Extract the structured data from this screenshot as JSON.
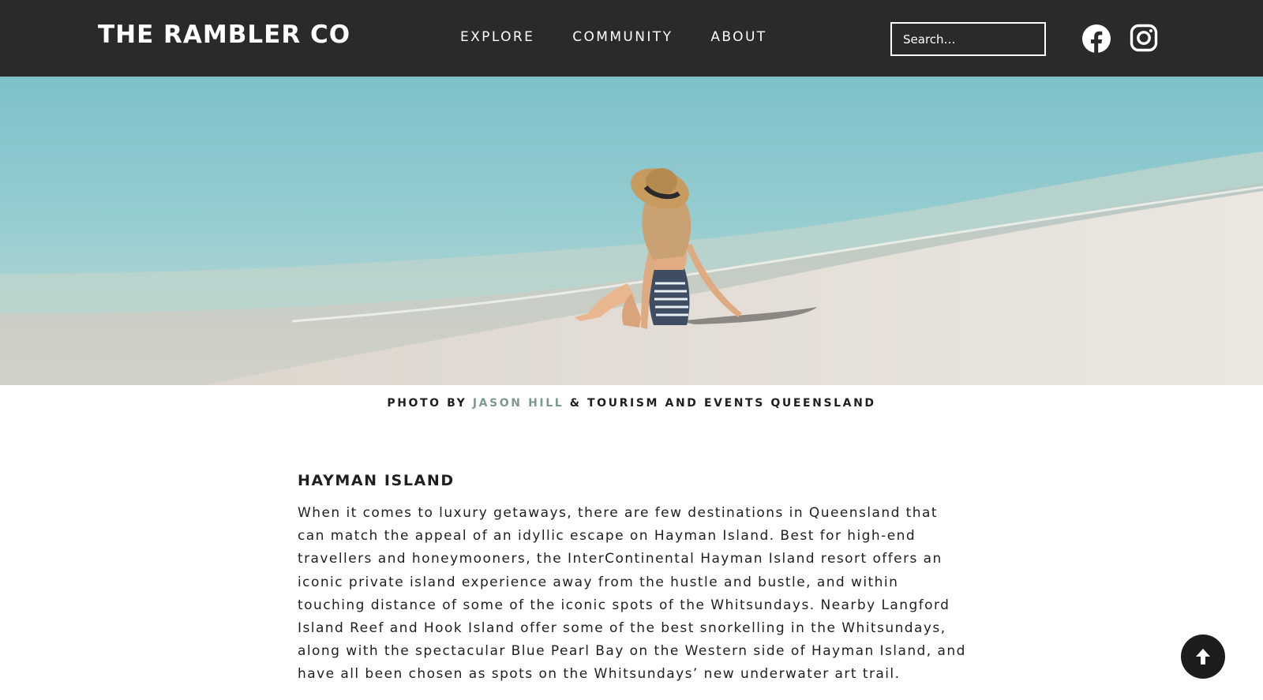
{
  "header": {
    "logo": "THE RAMBLER CO",
    "nav": [
      {
        "label": "EXPLORE"
      },
      {
        "label": "COMMUNITY"
      },
      {
        "label": "ABOUT"
      }
    ],
    "search": {
      "placeholder": "Search…"
    },
    "social": [
      {
        "icon": "facebook-icon"
      },
      {
        "icon": "instagram-icon"
      }
    ]
  },
  "hero": {
    "image": "woman-in-straw-hat-sitting-on-beach"
  },
  "caption": {
    "prefix": "PHOTO BY ",
    "photographer": "JASON HILL",
    "suffix": " & TOURISM AND EVENTS QUEENSLAND",
    "link_color": "#7d9a8f"
  },
  "article": {
    "heading": "HAYMAN ISLAND",
    "body": "When it comes to luxury getaways, there are few destinations in Queensland that can match the appeal of an idyllic escape on Hayman Island. Best for high-end travellers and honeymooners, the InterContinental Hayman Island resort offers an iconic private island experience away from the hustle and bustle, and within touching distance of some of the iconic spots of the Whitsundays. Nearby Langford Island Reef and Hook Island offer some of the best snorkelling in the Whitsundays, along with the spectacular Blue Pearl Bay on the Western side of Hayman Island, and have all been chosen as spots on the Whitsundays’ new underwater art trail."
  },
  "back_to_top": {
    "icon": "arrow-up-icon"
  },
  "colors": {
    "header_bg": "#2a2a2a",
    "accent": "#7d9a8f",
    "text": "#1f1f1f"
  }
}
